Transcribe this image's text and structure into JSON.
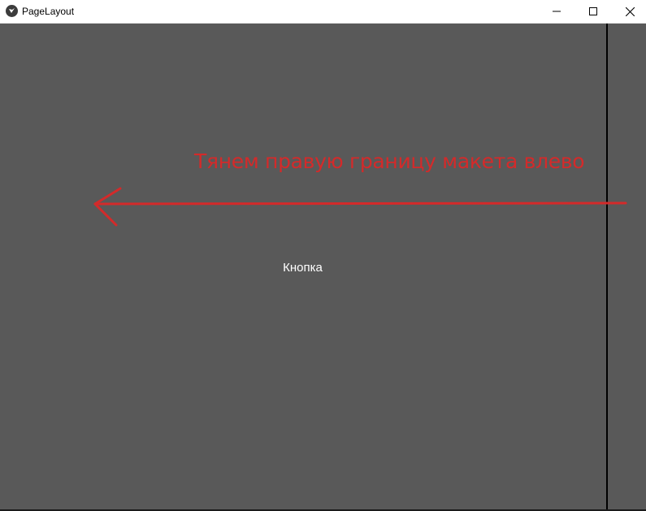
{
  "window": {
    "title": "PageLayout"
  },
  "controls": {
    "minimize": "minimize-icon",
    "maximize": "maximize-icon",
    "close": "close-icon"
  },
  "content": {
    "button_label": "Кнопка",
    "annotation": "Тянем правую границу макета влево"
  },
  "colors": {
    "background": "#595959",
    "annotation": "#d42a2a",
    "divider": "#000000"
  }
}
